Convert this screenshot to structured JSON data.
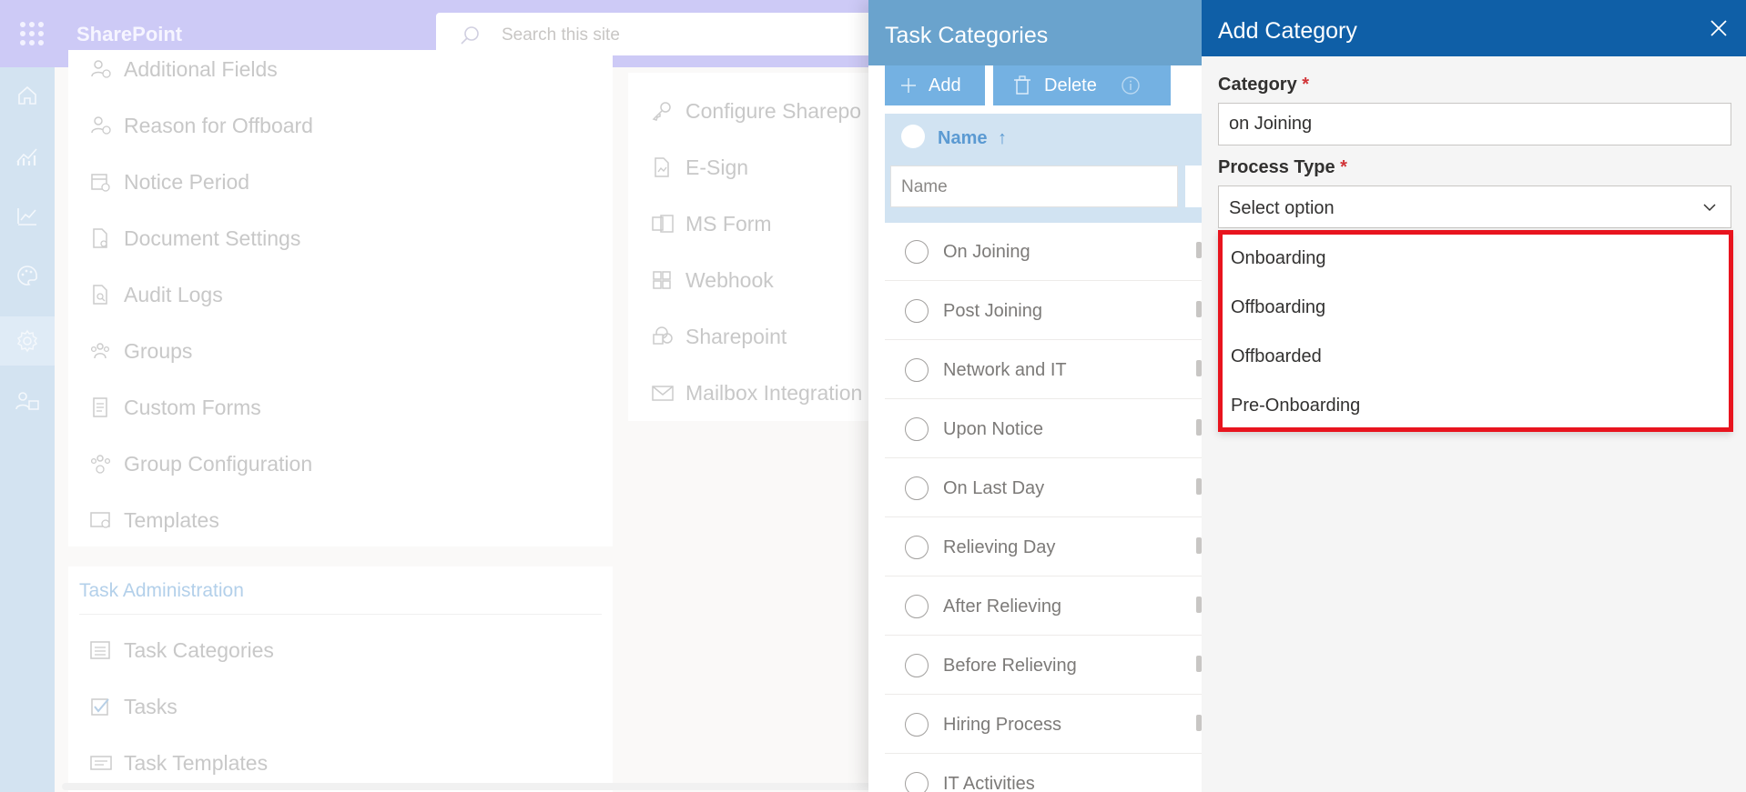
{
  "suite_bar": {
    "app_name": "SharePoint",
    "search_placeholder": "Search this site"
  },
  "left_rail": {
    "icons": [
      "home-icon",
      "analytics-icon",
      "trend-icon",
      "palette-icon",
      "settings-icon",
      "people-icon"
    ],
    "active": "settings-icon"
  },
  "settings": {
    "items": [
      {
        "label": "Additional Fields",
        "icon": "person-add-icon"
      },
      {
        "label": "Reason for Offboard",
        "icon": "person-remove-icon"
      },
      {
        "label": "Notice Period",
        "icon": "calendar-clock-icon"
      },
      {
        "label": "Document Settings",
        "icon": "document-gear-icon"
      },
      {
        "label": "Audit Logs",
        "icon": "document-search-icon"
      },
      {
        "label": "Groups",
        "icon": "people-icon"
      },
      {
        "label": "Custom Forms",
        "icon": "form-icon"
      },
      {
        "label": "Group Configuration",
        "icon": "people-gear-icon"
      },
      {
        "label": "Templates",
        "icon": "certificate-icon"
      }
    ],
    "task_section_title": "Task Administration",
    "task_items": [
      {
        "label": "Task Categories",
        "icon": "list-icon"
      },
      {
        "label": "Tasks",
        "icon": "checkbox-icon"
      },
      {
        "label": "Task Templates",
        "icon": "template-icon"
      }
    ],
    "integration_items": [
      {
        "label": "Configure Sharepo",
        "icon": "key-icon"
      },
      {
        "label": "E-Sign",
        "icon": "sign-icon"
      },
      {
        "label": "MS Form",
        "icon": "forms-icon"
      },
      {
        "label": "Webhook",
        "icon": "grid-icon"
      },
      {
        "label": "Sharepoint",
        "icon": "sharepoint-icon"
      },
      {
        "label": "Mailbox Integration",
        "icon": "mail-icon"
      }
    ]
  },
  "task_categories": {
    "title": "Task Categories",
    "add_label": "Add",
    "delete_label": "Delete",
    "column_name": "Name",
    "sort_glyph": "↑",
    "filter_placeholder": "Name",
    "rows": [
      "On Joining",
      "Post Joining",
      "Network and IT",
      "Upon Notice",
      "On Last Day",
      "Relieving Day",
      "After Relieving",
      "Before Relieving",
      "Hiring Process",
      "IT Activities"
    ]
  },
  "add_category": {
    "title": "Add Category",
    "category_label": "Category",
    "required_mark": "*",
    "category_value": "on Joining",
    "process_type_label": "Process Type",
    "process_type_value": "Select option",
    "options": [
      "Onboarding",
      "Offboarding",
      "Offboarded",
      "Pre-Onboarding"
    ]
  },
  "colors": {
    "suite_bar": "#cdcaf6",
    "task_panel_header": "#6aa3cd",
    "add_panel_header": "#0f5fa7",
    "highlight": "#e8141e",
    "required": "#d13438"
  }
}
